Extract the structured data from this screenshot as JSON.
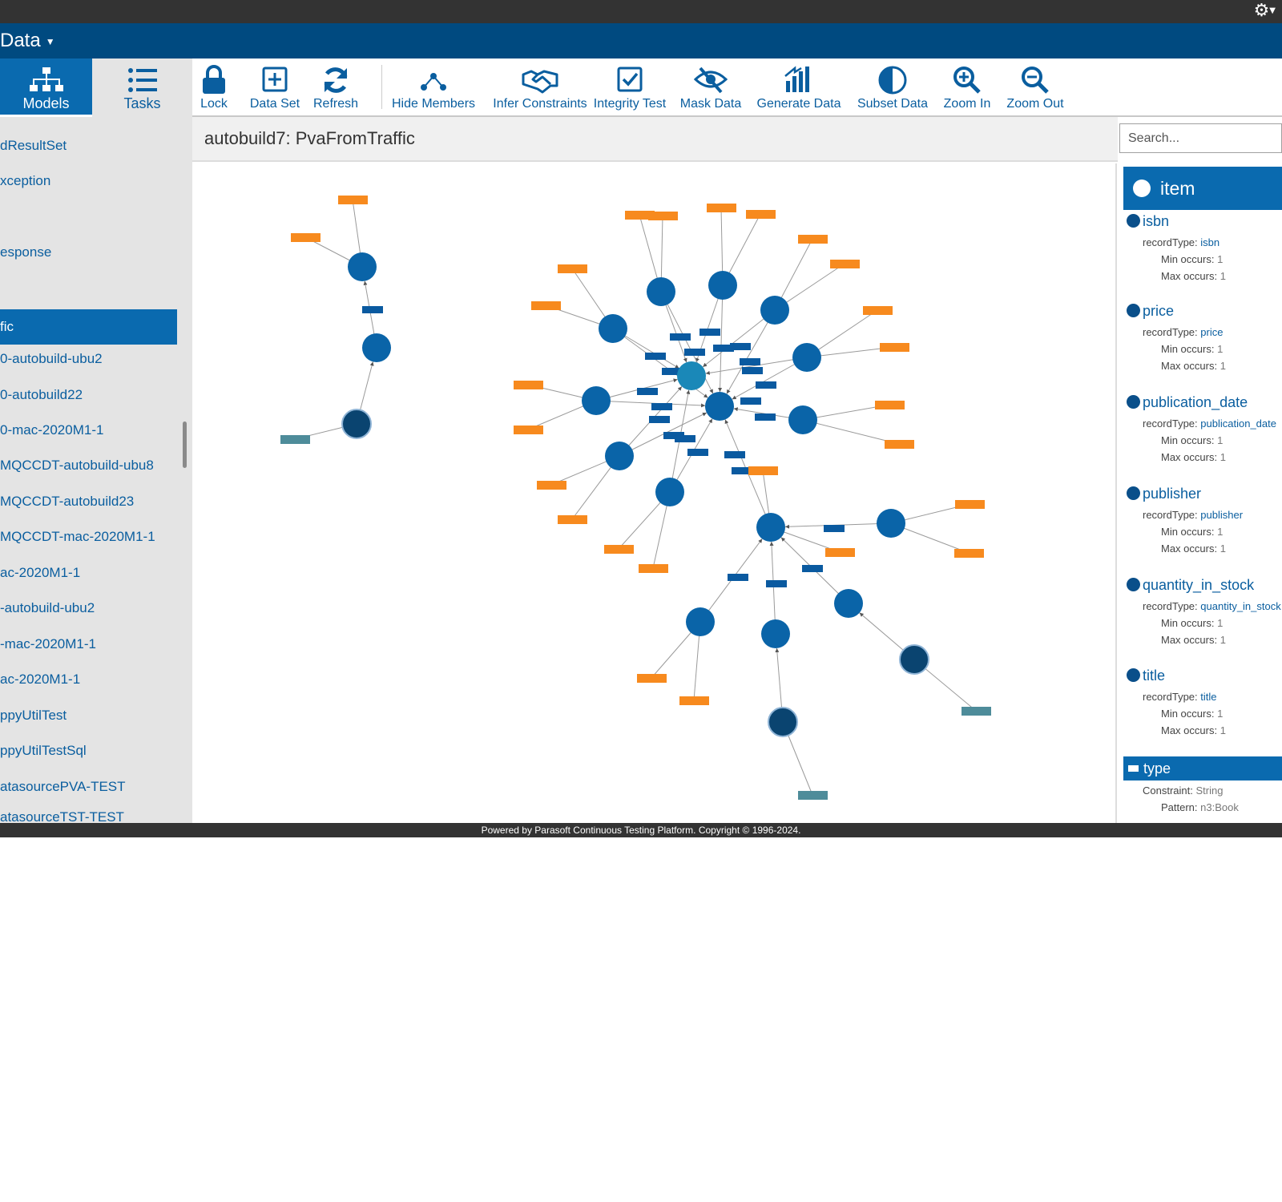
{
  "app": {
    "title": "Data"
  },
  "nav": {
    "models_label": "Models",
    "tasks_label": "Tasks"
  },
  "toolbar": {
    "lock": "Lock",
    "data_set": "Data Set",
    "refresh": "Refresh",
    "hide_members": "Hide Members",
    "infer_constraints": "Infer Constraints",
    "integrity_test": "Integrity Test",
    "mask_data": "Mask Data",
    "generate_data": "Generate Data",
    "subset_data": "Subset Data",
    "zoom_in": "Zoom In",
    "zoom_out": "Zoom Out"
  },
  "sidebar": {
    "items": [
      "dResultSet",
      "xception",
      "esponse",
      "fic",
      "0-autobuild-ubu2",
      "0-autobuild22",
      "0-mac-2020M1-1",
      "MQCCDT-autobuild-ubu8",
      "MQCCDT-autobuild23",
      "MQCCDT-mac-2020M1-1",
      "ac-2020M1-1",
      "-autobuild-ubu2",
      "-mac-2020M1-1",
      "ac-2020M1-1",
      "ppyUtilTest",
      "ppyUtilTestSql",
      "atasourcePVA-TEST",
      "atasourceTST-TEST"
    ]
  },
  "content": {
    "title": "autobuild7: PvaFromTraffic",
    "search_placeholder": "Search..."
  },
  "details": {
    "entity": "item",
    "labels": {
      "record_type": "recordType:",
      "min": "Min occurs:",
      "max": "Max occurs:",
      "constraint": "Constraint:",
      "pattern": "Pattern:"
    },
    "fields": [
      {
        "name": "isbn",
        "record_type": "isbn",
        "min": "1",
        "max": "1"
      },
      {
        "name": "price",
        "record_type": "price",
        "min": "1",
        "max": "1"
      },
      {
        "name": "publication_date",
        "record_type": "publication_date",
        "min": "1",
        "max": "1"
      },
      {
        "name": "publisher",
        "record_type": "publisher",
        "min": "1",
        "max": "1"
      },
      {
        "name": "quantity_in_stock",
        "record_type": "quantity_in_stock",
        "min": "1",
        "max": "1"
      },
      {
        "name": "title",
        "record_type": "title",
        "min": "1",
        "max": "1"
      }
    ],
    "type": {
      "name": "type",
      "constraint": "String",
      "pattern": "n3:Book"
    }
  },
  "footer": {
    "text": "Powered by Parasoft Continuous Testing Platform. Copyright © 1996-2024."
  },
  "colors": {
    "header": "#004a80",
    "accent": "#0a6aaf",
    "node": "#0a64a8",
    "node_dark": "#0a4470",
    "node_light": "#1a88b8",
    "leaf": "#f78a1e",
    "edge_label": "#0a5aa0",
    "teal_leaf": "#4e8c9a"
  }
}
